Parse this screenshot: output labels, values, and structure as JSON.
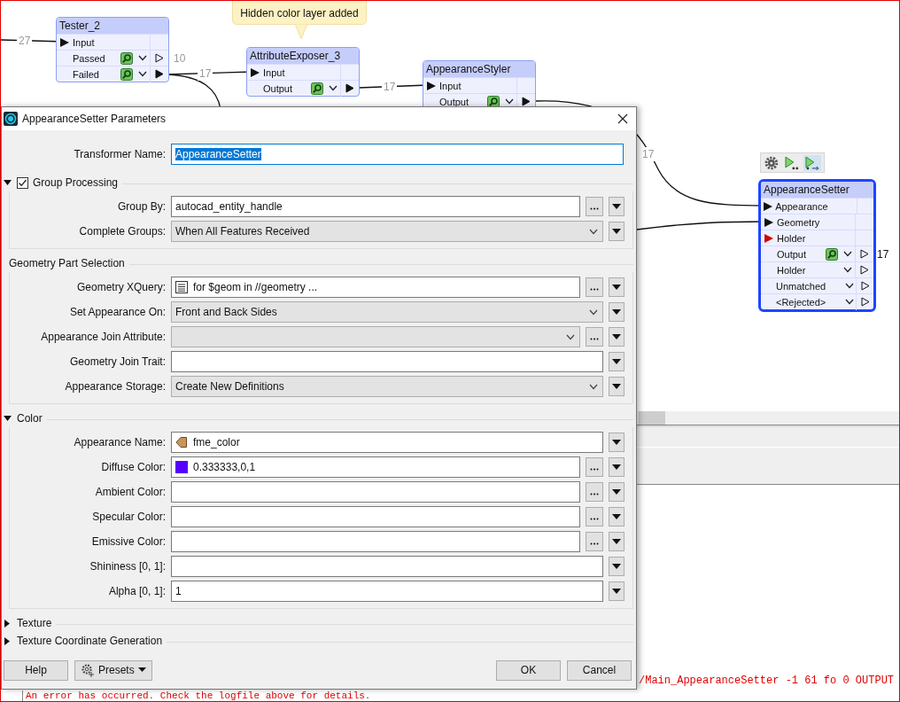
{
  "canvas": {
    "annotation": {
      "text": "Hidden color layer added"
    },
    "nodes": [
      {
        "name": "Tester_2",
        "selected": false,
        "ports": [
          {
            "kind": "input",
            "label": "Input"
          },
          {
            "kind": "output",
            "label": "Passed",
            "inspect": true,
            "connected": false,
            "count": "10"
          },
          {
            "kind": "output",
            "label": "Failed",
            "inspect": true,
            "connected": true
          }
        ]
      },
      {
        "name": "AttributeExposer_3",
        "selected": false,
        "ports": [
          {
            "kind": "input",
            "label": "Input"
          },
          {
            "kind": "output",
            "label": "Output",
            "inspect": true,
            "connected": true
          }
        ]
      },
      {
        "name": "AppearanceStyler",
        "selected": false,
        "ports": [
          {
            "kind": "input",
            "label": "Input"
          },
          {
            "kind": "output",
            "label": "Output",
            "inspect": true,
            "connected": true
          }
        ]
      },
      {
        "name": "AppearanceSetter",
        "selected": true,
        "ports": [
          {
            "kind": "input",
            "label": "Appearance"
          },
          {
            "kind": "input",
            "label": "Geometry"
          },
          {
            "kind": "required_input",
            "label": "Holder"
          },
          {
            "kind": "output",
            "label": "Output",
            "inspect": true,
            "connected": false,
            "count": "17"
          },
          {
            "kind": "output",
            "label": "Holder",
            "inspect": false,
            "connected": false
          },
          {
            "kind": "output",
            "label": "Unmatched",
            "inspect": false,
            "connected": false
          },
          {
            "kind": "output",
            "label": "<Rejected>",
            "inspect": false,
            "connected": false
          }
        ]
      }
    ],
    "link_counts": [
      "27",
      "17",
      "17",
      "17"
    ]
  },
  "dialog": {
    "title": "AppearanceSetter Parameters",
    "transformer_name": {
      "label": "Transformer Name:",
      "value": "AppearanceSetter",
      "selected": true
    },
    "sections": [
      {
        "title": "Group Processing",
        "kind": "collapsible",
        "expanded": true,
        "checked": true,
        "rows": [
          {
            "label": "Group By:",
            "kind": "text",
            "value": "autocad_entity_handle",
            "more": true
          },
          {
            "label": "Complete Groups:",
            "kind": "select",
            "value": "When All Features Received",
            "more": false
          }
        ]
      },
      {
        "title": "Geometry Part Selection",
        "kind": "group",
        "rows": [
          {
            "label": "Geometry XQuery:",
            "kind": "xquery",
            "value": "for $geom in //geometry ...",
            "more": true
          },
          {
            "label": "Set Appearance On:",
            "kind": "select",
            "value": "Front and Back Sides",
            "more": false
          },
          {
            "label": "Appearance Join Attribute:",
            "kind": "select",
            "more": true
          },
          {
            "label": "Geometry Join Trait:",
            "kind": "text",
            "more": false
          },
          {
            "label": "Appearance Storage:",
            "kind": "select",
            "value": "Create New Definitions",
            "more": false
          }
        ]
      },
      {
        "title": "Color",
        "kind": "collapsible",
        "expanded": true,
        "rows": [
          {
            "label": "Appearance Name:",
            "kind": "attribute",
            "value": "fme_color",
            "more": false
          },
          {
            "label": "Diffuse Color:",
            "kind": "color",
            "color": "#5500ff",
            "value": "0.333333,0,1",
            "more": true
          },
          {
            "label": "Ambient Color:",
            "kind": "text",
            "more": true
          },
          {
            "label": "Specular Color:",
            "kind": "text",
            "more": true
          },
          {
            "label": "Emissive Color:",
            "kind": "text",
            "more": true
          },
          {
            "label": "Shininess [0, 1]:",
            "kind": "text",
            "more": false
          },
          {
            "label": "Alpha [0, 1]:",
            "kind": "text",
            "value": "1",
            "more": false
          }
        ]
      },
      {
        "title": "Texture",
        "kind": "collapsible",
        "expanded": false
      },
      {
        "title": "Texture Coordinate Generation",
        "kind": "collapsible",
        "expanded": false
      }
    ],
    "buttons": [
      {
        "label": "Help",
        "kind": "plain"
      },
      {
        "label": "Presets",
        "kind": "menu"
      },
      {
        "label": "OK",
        "kind": "plain"
      },
      {
        "label": "Cancel",
        "kind": "plain"
      }
    ]
  },
  "log": {
    "lines": [
      {
        "kind": "error",
        "text": "/Main_AppearanceSetter -1 61 fo 0 OUTPUT"
      },
      {
        "kind": "error",
        "text": "An error has occurred. Check the logfile above for details."
      }
    ]
  }
}
